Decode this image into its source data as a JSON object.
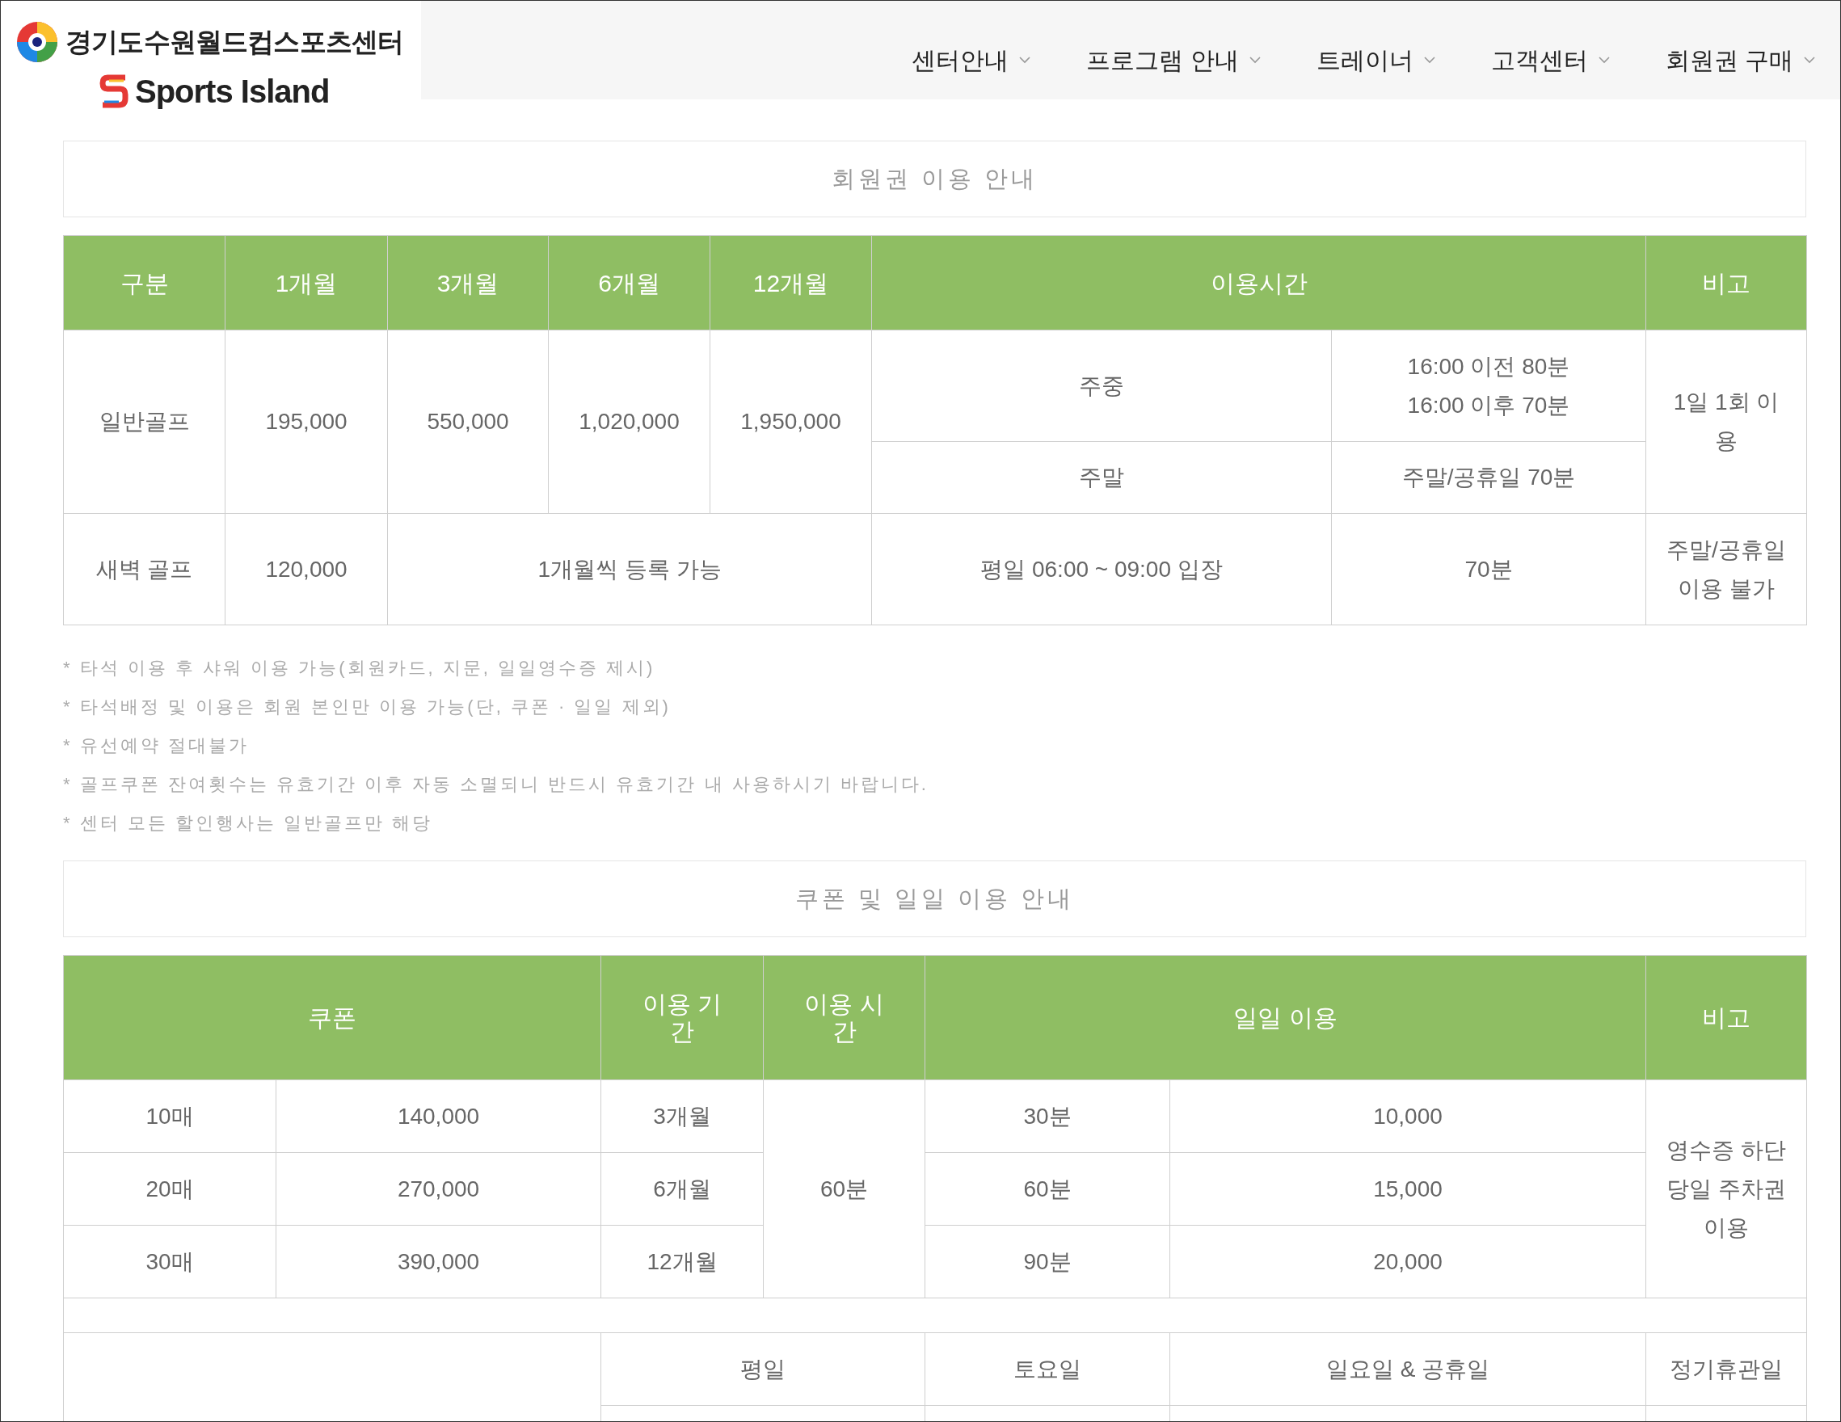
{
  "header": {
    "logo_title": "경기도수원월드컵스포츠센터",
    "logo_subtitle": "Sports Island"
  },
  "nav": [
    {
      "label": "센터안내"
    },
    {
      "label": "프로그램 안내"
    },
    {
      "label": "트레이너"
    },
    {
      "label": "고객센터"
    },
    {
      "label": "회원권 구매"
    }
  ],
  "membership": {
    "title": "회원권 이용 안내",
    "columns": [
      "구분",
      "1개월",
      "3개월",
      "6개월",
      "12개월",
      "이용시간",
      "비고"
    ],
    "general": {
      "name": "일반골프",
      "prices": [
        "195,000",
        "550,000",
        "1,020,000",
        "1,950,000"
      ],
      "weekday_label": "주중",
      "weekday_lines": [
        "16:00 이전 80분",
        "16:00 이후 70분"
      ],
      "weekend_label": "주말",
      "weekend_text": "주말/공휴일 70분",
      "note": "1일 1회 이용"
    },
    "dawn": {
      "name": "새벽 골프",
      "price": "120,000",
      "registration": "1개월씩 등록 가능",
      "hours": "평일 06:00 ~ 09:00 입장",
      "duration": "70분",
      "note": "주말/공휴일 이용 불가"
    }
  },
  "notes": [
    "* 타석 이용 후 샤워 이용 가능(회원카드, 지문, 일일영수증 제시)",
    "* 타석배정 및 이용은 회원 본인만 이용 가능(단, 쿠폰 · 일일 제외)",
    "* 유선예약 절대불가",
    "* 골프쿠폰 잔여횟수는 유효기간 이후 자동 소멸되니 반드시 유효기간 내 사용하시기 바랍니다.",
    "* 센터 모든 할인행사는 일반골프만 해당"
  ],
  "coupon": {
    "title": "쿠폰 및 일일 이용 안내",
    "columns": [
      "쿠폰",
      "이용 기간",
      "이용 시간",
      "일일 이용",
      "비고"
    ],
    "rows": [
      {
        "count": "10매",
        "price": "140,000",
        "period": "3개월",
        "daily_time": "30분",
        "daily_price": "10,000"
      },
      {
        "count": "20매",
        "price": "270,000",
        "period": "6개월",
        "daily_time": "60분",
        "daily_price": "15,000"
      },
      {
        "count": "30매",
        "price": "390,000",
        "period": "12개월",
        "daily_time": "90분",
        "daily_price": "20,000"
      }
    ],
    "duration": "60분",
    "note": "영수증 하단 당일 주차권 이용",
    "schedule_columns": [
      "평일",
      "토요일",
      "일요일 & 공휴일",
      "정기휴관일"
    ]
  }
}
